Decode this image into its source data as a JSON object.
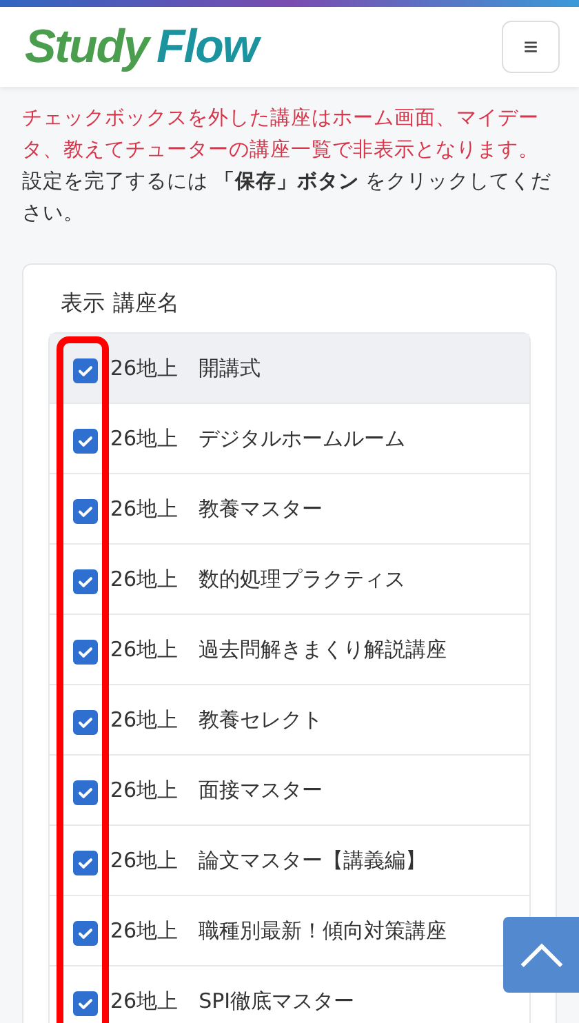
{
  "header": {
    "logo_first": "Study",
    "logo_second": "Flow",
    "menu_button": "≡"
  },
  "notice": {
    "warning": "チェックボックスを外した講座はホーム画面、マイデータ、教えてチューターの講座一覧で非表示となります。",
    "instruction": "設定を完了するには **「保存」ボタン** をクリックしてください。"
  },
  "table": {
    "columns": [
      "表示",
      "講座名"
    ],
    "rows": [
      {
        "name": "26地上　開講式",
        "checked": true,
        "selected": true
      },
      {
        "name": "26地上　デジタルホームルーム",
        "checked": true,
        "selected": false
      },
      {
        "name": "26地上　教養マスター",
        "checked": true,
        "selected": false
      },
      {
        "name": "26地上　数的処理プラクティス",
        "checked": true,
        "selected": false
      },
      {
        "name": "26地上　過去問解きまくり解説講座",
        "checked": true,
        "selected": false
      },
      {
        "name": "26地上　教養セレクト",
        "checked": true,
        "selected": false
      },
      {
        "name": "26地上　面接マスター",
        "checked": true,
        "selected": false
      },
      {
        "name": "26地上　論文マスター【講義編】",
        "checked": true,
        "selected": false
      },
      {
        "name": "26地上　職種別最新！傾向対策講座",
        "checked": true,
        "selected": false
      },
      {
        "name": "26地上　SPI徹底マスター",
        "checked": true,
        "selected": false
      }
    ]
  },
  "annotation": {
    "highlight": true
  }
}
